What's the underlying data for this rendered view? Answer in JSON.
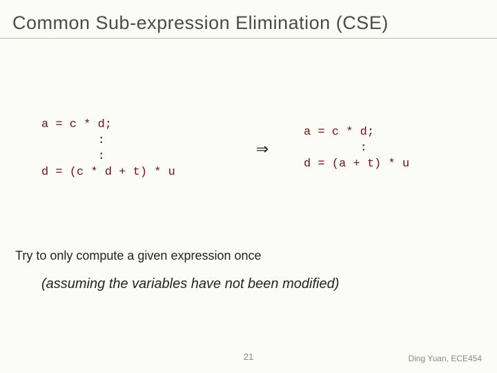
{
  "title": "Common  Sub-expression Elimination (CSE)",
  "code_left": "a = c * d;\n        :\n        :\nd = (c * d + t) * u",
  "arrow": "⇒",
  "code_right": "a = c * d;\n        :\nd = (a + t) * u",
  "explain": "Try to only compute a given expression once",
  "assume": "(assuming the variables have not been modified)",
  "page_number": "21",
  "footer": "Ding Yuan, ECE454"
}
